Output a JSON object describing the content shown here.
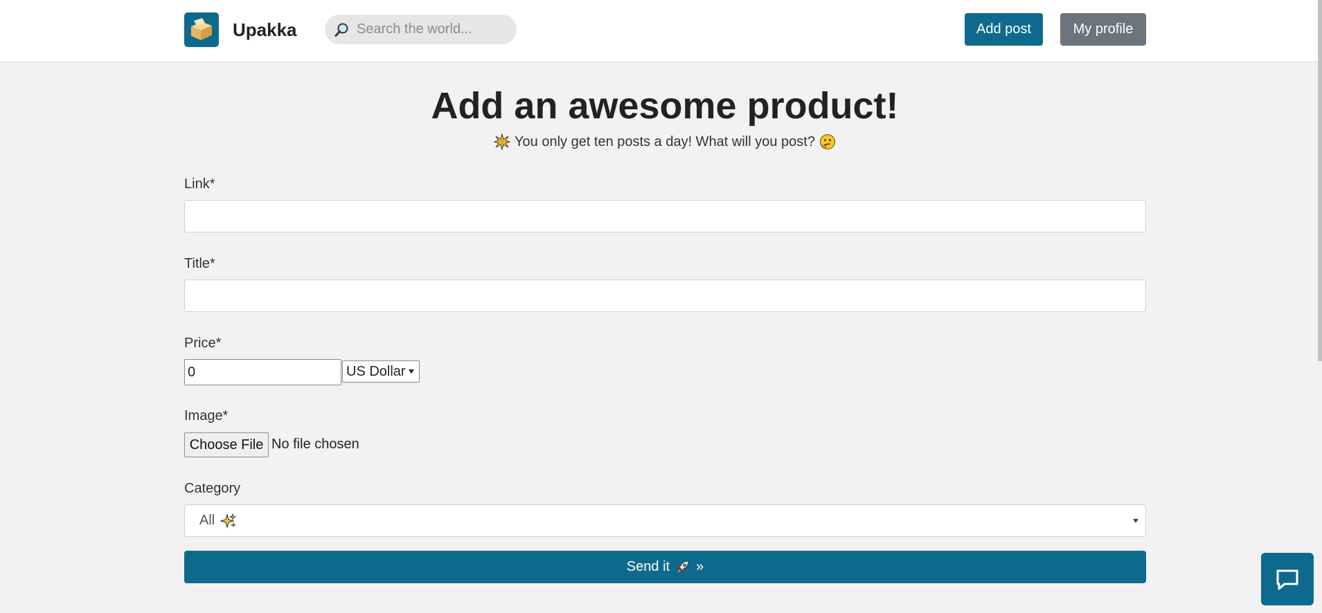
{
  "header": {
    "brand_name": "Upakka",
    "search_placeholder": "Search the world...",
    "add_post_label": "Add post",
    "my_profile_label": "My profile"
  },
  "main": {
    "title": "Add an awesome product!",
    "subtitle": "You only get ten posts a day! What will you post?",
    "subtitle_icons": [
      "collision-emoji-icon",
      "thinking-face-emoji-icon"
    ]
  },
  "form": {
    "link_label": "Link*",
    "link_value": "",
    "title_label": "Title*",
    "title_value": "",
    "price_label": "Price*",
    "price_value": "0",
    "currency_selected": "US Dollar",
    "image_label": "Image*",
    "choose_file_label": "Choose File",
    "file_status": "No file chosen",
    "category_label": "Category",
    "category_selected": "All",
    "category_icon": "sparkles-emoji-icon",
    "submit_label_prefix": "Send it",
    "submit_icon": "rocket-emoji-icon",
    "submit_label_suffix": "»"
  },
  "colors": {
    "primary": "#0e6a8d",
    "secondary": "#6c757d",
    "page_background": "#f2f2f2"
  },
  "widgets": {
    "chat_icon": "chat-bubble-icon"
  }
}
